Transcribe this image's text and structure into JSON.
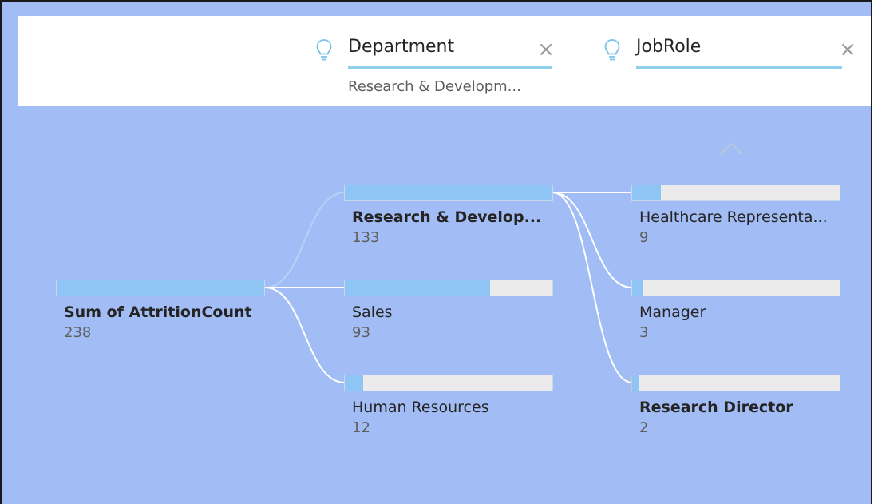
{
  "levels": [
    {
      "title": "Department",
      "selection": "Research & Developm..."
    },
    {
      "title": "JobRole",
      "selection": ""
    }
  ],
  "close_glyph": "×",
  "icons": {
    "level_icon": "lightbulb-icon",
    "close": "close-icon",
    "scroll": "chevron-up-icon"
  },
  "colors": {
    "background": "#a2bdf5",
    "bar_fill": "#8fc5f5",
    "bar_track": "#ebebeb",
    "underline": "#8fd0ec"
  },
  "root": {
    "label": "Sum of AttritionCount",
    "value": "238"
  },
  "departments": [
    {
      "label": "Research & Develop...",
      "value": "133",
      "selected": true,
      "fraction": 1.0
    },
    {
      "label": "Sales",
      "value": "93",
      "selected": false,
      "fraction": 0.7
    },
    {
      "label": "Human Resources",
      "value": "12",
      "selected": false,
      "fraction": 0.09
    }
  ],
  "job_roles": [
    {
      "label": "Healthcare Representa...",
      "value": "9",
      "selected": false,
      "fraction": 0.14
    },
    {
      "label": "Manager",
      "value": "3",
      "selected": false,
      "fraction": 0.05
    },
    {
      "label": "Research Director",
      "value": "2",
      "selected": true,
      "fraction": 0.03
    }
  ]
}
